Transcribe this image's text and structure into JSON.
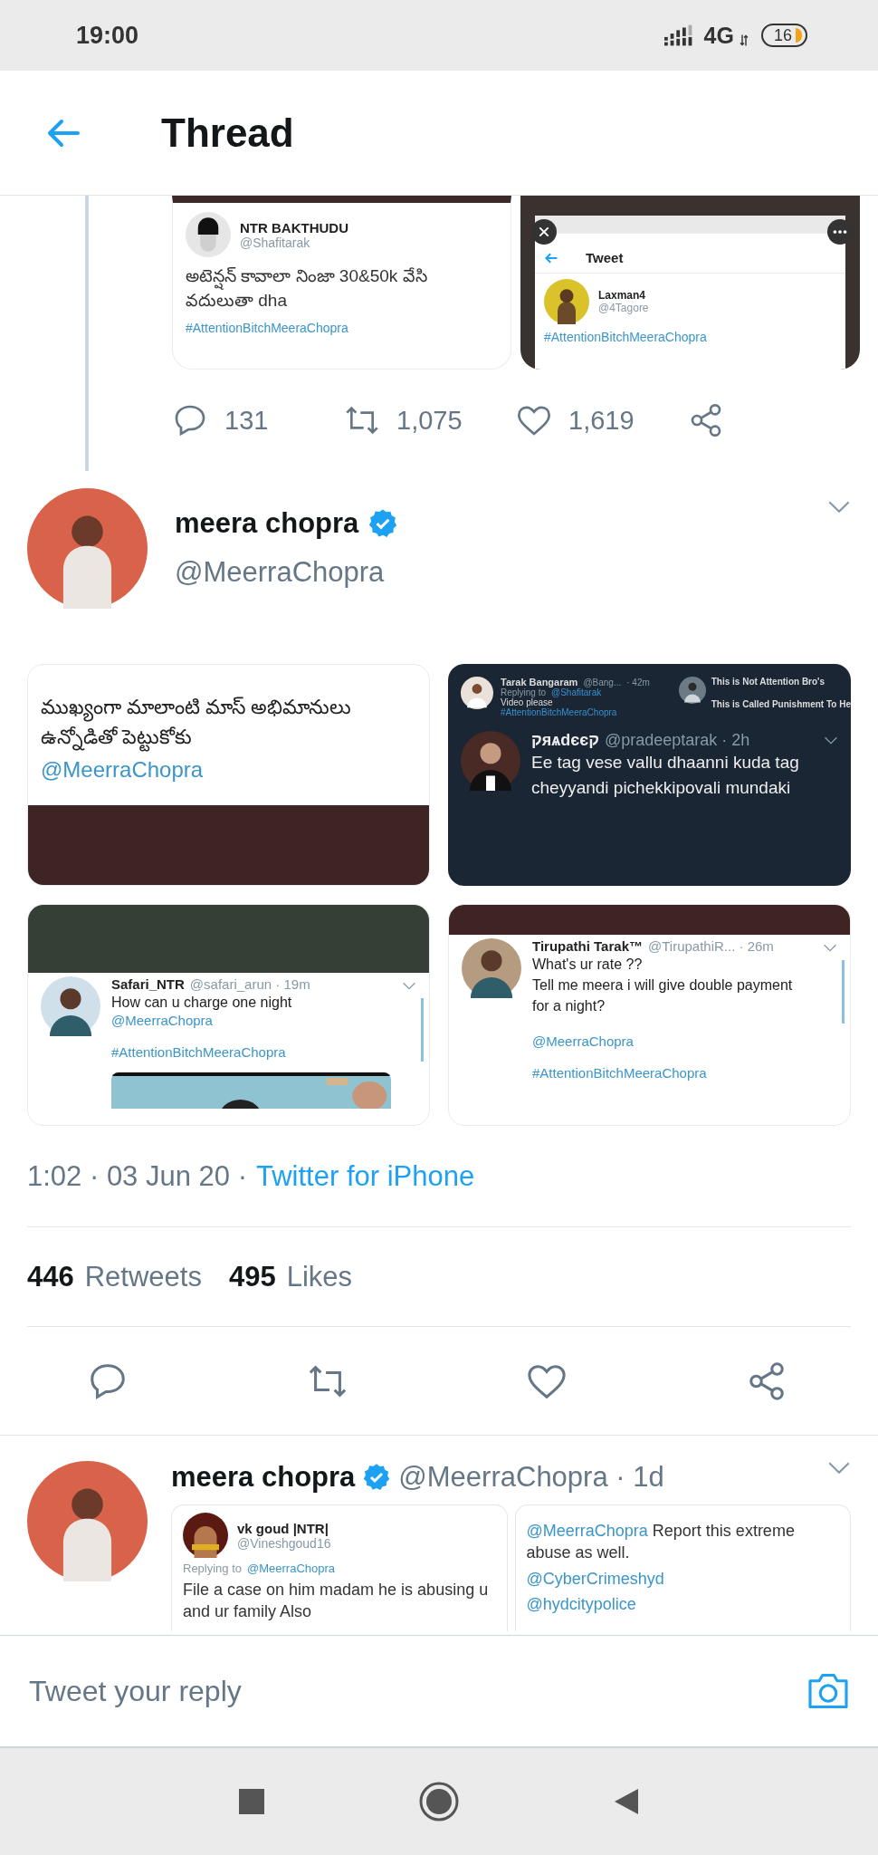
{
  "status_bar": {
    "time": "19:00",
    "network": "4G",
    "battery": "16"
  },
  "header": {
    "title": "Thread"
  },
  "previous_tweet": {
    "media": [
      {
        "kind": "tweet_shot",
        "name": "NTR BAKTHUDU",
        "handle": "@Shafitarak",
        "text": "అటెన్షన్ కావాలా నింజా 30&50k వేసి వదులుతా dha",
        "hashtag": "#AttentionBitchMeeraChopra"
      },
      {
        "kind": "phone_shot",
        "title": "Tweet",
        "name": "Laxman4",
        "handle": "@4Tagore",
        "hashtag": "#AttentionBitchMeeraChopra"
      }
    ],
    "actions": [
      {
        "kind": "reply",
        "count": "131"
      },
      {
        "kind": "retweet",
        "count": "1,075"
      },
      {
        "kind": "like",
        "count": "1,619"
      },
      {
        "kind": "share"
      }
    ]
  },
  "tweet": {
    "name": "meera chopra",
    "verified": true,
    "handle": "@MeerraChopra",
    "media": [
      {
        "kind": "text_shot",
        "text": "ముఖ్యంగా మాలాంటి మాస్ అభిమానులు ఉన్నోడితో పెట్టుకోకు",
        "mention": "@MeerraChopra"
      },
      {
        "kind": "dark_shot",
        "reply_name": "Tarak Bangaram",
        "reply_handle": "@Bang...",
        "reply_meta": "· 42m",
        "replying": "Replying to",
        "replying_to": "@Shafitarak",
        "reply_text": "Video please",
        "reply_hashtag": "#AttentionBitchMeeraChopra",
        "side": [
          "This is Not Attention Bro's",
          "This is Called Punishment To He"
        ],
        "name": "קяѧdєєק",
        "handle": "@pradeeptarak · 2h",
        "text": "Ee tag vese vallu dhaanni kuda tag cheyyandi pichekkipovali mundaki"
      },
      {
        "kind": "post_shot_picture",
        "name": "Safari_NTR",
        "handle": "@safari_arun · 19m",
        "lines": [
          "How can u charge one night"
        ],
        "mention": "@MeerraChopra",
        "hashtag": "#AttentionBitchMeeraChopra"
      },
      {
        "kind": "post_shot",
        "name": "Tirupathi Tarak™",
        "handle": "@TirupathiR... · 26m",
        "lines": [
          "What's ur rate ??",
          "Tell me meera i will give double payment for a night?"
        ],
        "mention": "@MeerraChopra",
        "hashtag": "#AttentionBitchMeeraChopra"
      }
    ],
    "time": "1:02 · 03 Jun 20 ·",
    "source": "Twitter for iPhone",
    "stats": [
      {
        "count": "446",
        "label": "Retweets"
      },
      {
        "count": "495",
        "label": "Likes"
      }
    ],
    "actions": [
      {
        "kind": "reply"
      },
      {
        "kind": "retweet"
      },
      {
        "kind": "like"
      },
      {
        "kind": "share"
      }
    ]
  },
  "next_tweet": {
    "name": "meera chopra",
    "verified": true,
    "handle": "@MeerraChopra · 1d",
    "media": [
      {
        "kind": "reply_shot",
        "name": "vk goud |NTR|",
        "handle": "@Vineshgoud16",
        "replying": "Replying to",
        "replying_to": "@MeerraChopra",
        "text": "File a case on him madam he is abusing u and ur family Also"
      },
      {
        "kind": "mention_shot",
        "mention": "@MeerraChopra",
        "text": "Report this extreme abuse as well.",
        "tags": [
          "@CyberCrimeshyd",
          "@hydcitypolice"
        ]
      }
    ]
  },
  "reply_bar": {
    "placeholder": "Tweet your reply"
  }
}
